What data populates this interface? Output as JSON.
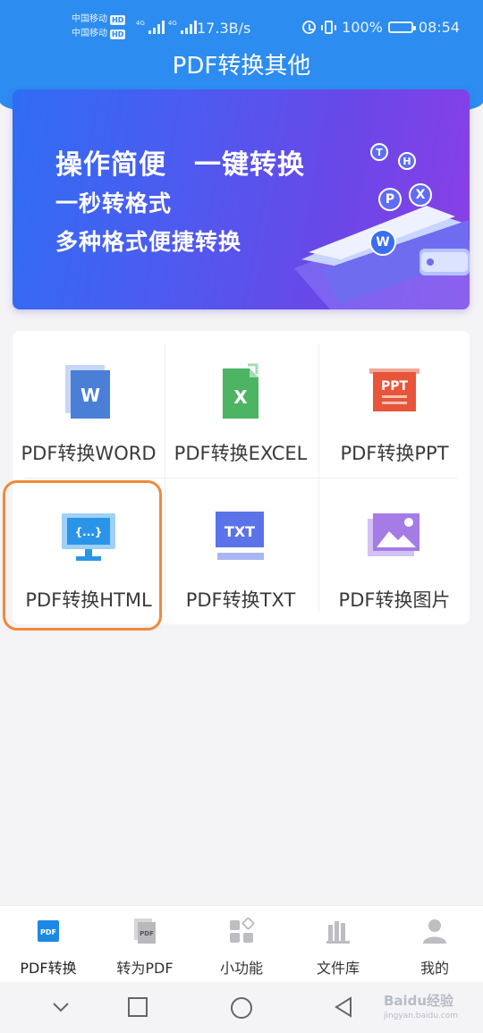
{
  "status_bar": {
    "carrier_1": "中国移动",
    "carrier_2": "中国移动",
    "hd_badge": "HD",
    "network_type": "4G",
    "net_speed": "17.3B/s",
    "battery_level": "100%",
    "time": "08:54"
  },
  "header": {
    "title": "PDF转换其他"
  },
  "banner": {
    "line_1": "操作简便　一键转换",
    "line_2": "一秒转格式",
    "line_3": "多种格式便捷转换",
    "bubbles": [
      "T",
      "H",
      "P",
      "X",
      "W"
    ]
  },
  "tools": [
    {
      "label": "PDF转换WORD",
      "icon": "word-doc-icon",
      "glyph": "W",
      "color": "#4a7fd8"
    },
    {
      "label": "PDF转换EXCEL",
      "icon": "excel-doc-icon",
      "glyph": "X",
      "color": "#4cb463"
    },
    {
      "label": "PDF转换PPT",
      "icon": "ppt-board-icon",
      "glyph": "PPT",
      "color": "#e8553a"
    },
    {
      "label": "PDF转换HTML",
      "icon": "html-monitor-icon",
      "glyph": "{...}",
      "color": "#2a95e8"
    },
    {
      "label": "PDF转换TXT",
      "icon": "txt-doc-icon",
      "glyph": "TXT",
      "color": "#5b73e8"
    },
    {
      "label": "PDF转换图片",
      "icon": "image-icon",
      "glyph": "",
      "color": "#a57be6"
    }
  ],
  "highlighted_tool": "PDF转换HTML",
  "bottom_nav": {
    "items": [
      {
        "label": "PDF转换",
        "icon": "pdf-convert-icon",
        "badge": "PDF",
        "active": true
      },
      {
        "label": "转为PDF",
        "icon": "to-pdf-icon",
        "badge": "PDF",
        "active": false
      },
      {
        "label": "小功能",
        "icon": "grid-tools-icon",
        "active": false
      },
      {
        "label": "文件库",
        "icon": "file-library-icon",
        "active": false
      },
      {
        "label": "我的",
        "icon": "user-icon",
        "active": false
      }
    ]
  },
  "watermark": {
    "brand": "Baidu经验",
    "url": "jingyan.baidu.com"
  },
  "colors": {
    "header_blue": "#2c8cf0",
    "highlight_orange": "#f08a3a",
    "active_nav_blue": "#1e88e5"
  }
}
